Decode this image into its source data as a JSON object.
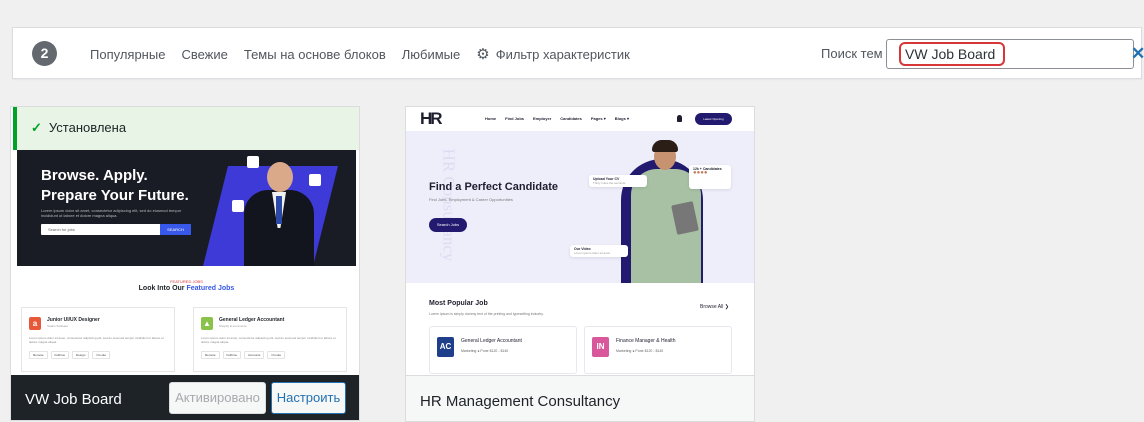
{
  "filter": {
    "count": "2",
    "tabs": [
      "Популярные",
      "Свежие",
      "Темы на основе блоков",
      "Любимые"
    ],
    "feature_filter": "Фильтр характеристик",
    "search_label": "Поиск тем",
    "search_value": "VW Job Board"
  },
  "themes": [
    {
      "name": "VW Job Board",
      "installed_label": "Установлена",
      "activated_label": "Активировано",
      "customize_label": "Настроить",
      "preview": {
        "headline1": "Browse. Apply.",
        "headline2": "Prepare Your Future.",
        "lorem": "Lorem ipsum dolor sit amet, consectetur adipiscing elit, sed do eiusmod tempor incididunt ut labore et dolore magna aliqua.",
        "search_placeholder": "Search for jobs",
        "search_button": "SEARCH",
        "section_tag": "FEATURED JOBS",
        "section_title_a": "Look Into Our",
        "section_title_b": "Featured Jobs",
        "jobs": [
          {
            "title": "Junior UI/UX Designer",
            "sub": "Studio Software",
            "logo": "a",
            "color": "#e8593a",
            "text": "Lorem ipsum dolor sit amet, consectetur adipiscing elit, sed do eiusmod tempor incididunt ut labore et dolore magna aliqua.",
            "tags": [
              "Remote",
              "Fulltime",
              "Design",
              "On-site"
            ]
          },
          {
            "title": "General Ledger Accountant",
            "sub": "Shopify E-commerce",
            "logo": "▲",
            "color": "#8bc34a",
            "text": "Lorem ipsum dolor sit amet, consectetur adipiscing elit, sed do eiusmod tempor incididunt ut labore et dolore magna aliqua.",
            "tags": [
              "Remote",
              "Fulltime",
              "Accounts",
              "On-site"
            ]
          }
        ]
      }
    },
    {
      "name": "HR Management Consultancy",
      "preview": {
        "logo": "HR",
        "menu": [
          "Home",
          "Find Jobs",
          "Employer",
          "Candidates",
          "Pages ▾",
          "Blogs ▾"
        ],
        "open_button": "Latest Opening",
        "watermark": "HR Consultancy",
        "title": "Find a Perfect Candidate",
        "subtitle": "Find Jobs, Employment & Career Opportunities",
        "cta": "Search Jobs",
        "card_cv_title": "Upload Your CV",
        "card_cv_sub": "Thirty miles the seconds",
        "card_cand_title": "12k + Candidates",
        "card_video_title": "Our Video",
        "card_video_sub": "Lorem ipsum dolor sit amet",
        "popular_title": "Most Popular Job",
        "popular_sub": "Lorem Ipsum is simply dummy text of the printing and typesetting industry.",
        "browse_all": "Browse All ❯",
        "jobs": [
          {
            "title": "General Ledger Accountant",
            "logo": "AC",
            "color": "#1f3f8a",
            "meta": "Marketing    ● Pune    $120 - $140"
          },
          {
            "title": "Finance Manager & Health",
            "logo": "IN",
            "color": "#d9579b",
            "meta": "Marketing    ● Pune    $120 - $140"
          }
        ]
      }
    }
  ],
  "colors": {
    "accent": "#2271b1",
    "installed_green": "#00a32a",
    "highlight_red": "#d63638",
    "dark_bar": "#1d2327"
  }
}
